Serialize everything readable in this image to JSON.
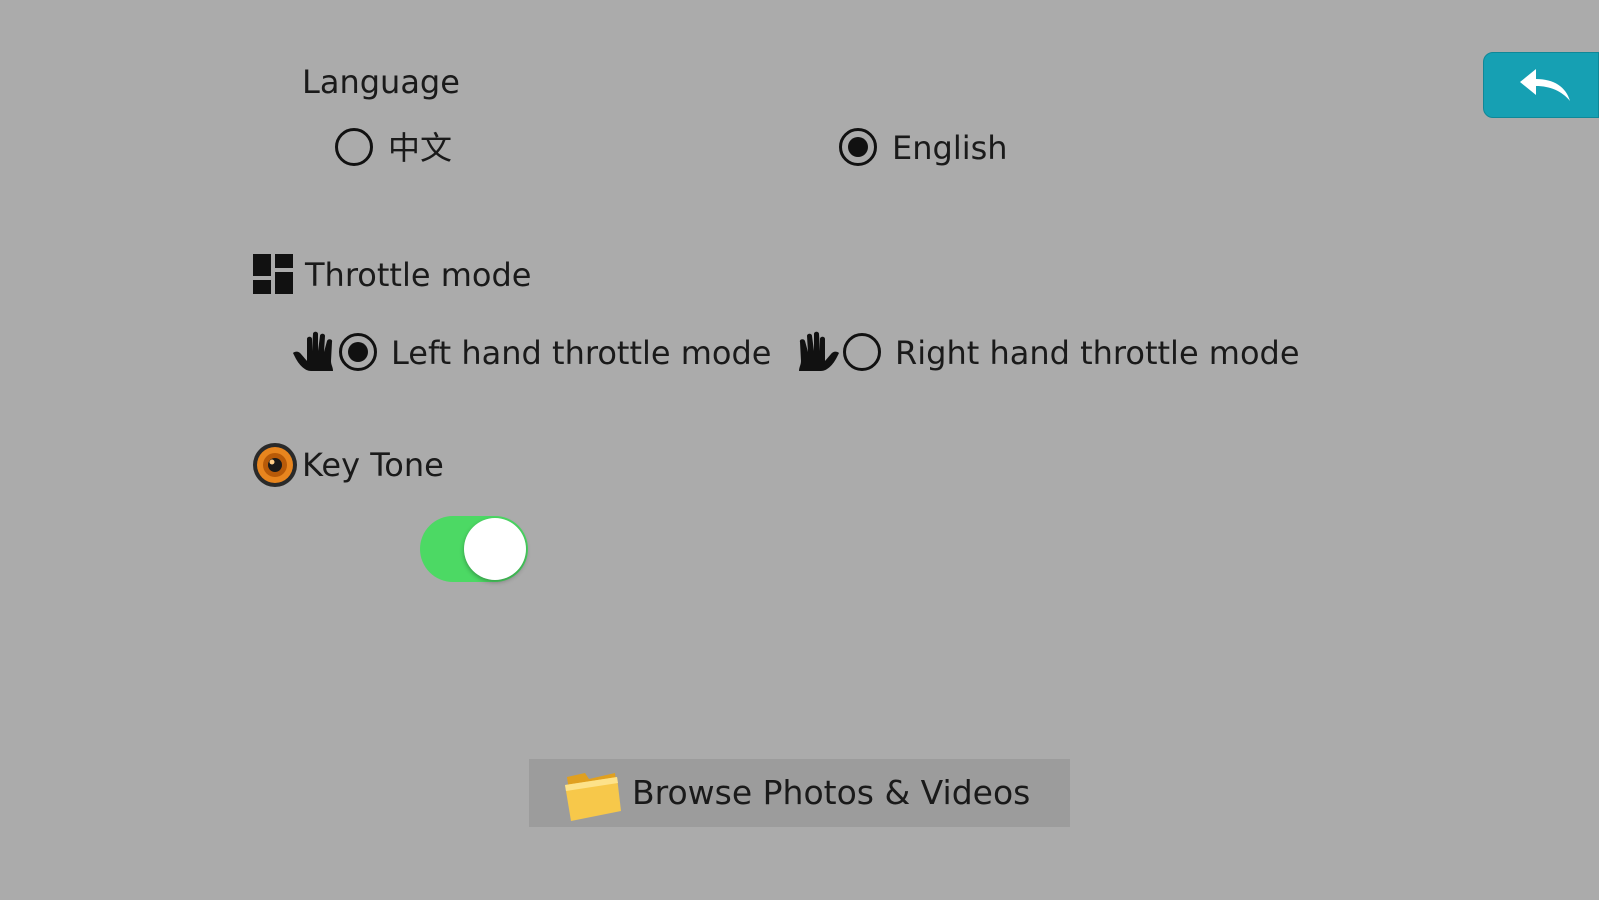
{
  "header": {
    "back_icon": "undo-arrow-icon"
  },
  "language": {
    "title": "Language",
    "options": [
      {
        "label": "中文",
        "checked": false
      },
      {
        "label": "English",
        "checked": true
      }
    ]
  },
  "throttle": {
    "title": "Throttle mode",
    "title_icon": "grid-layout-icon",
    "options": [
      {
        "label": "Left hand throttle mode",
        "checked": true,
        "icon": "left-hand-icon"
      },
      {
        "label": "Right hand throttle mode",
        "checked": false,
        "icon": "right-hand-icon"
      }
    ]
  },
  "key_tone": {
    "title": "Key Tone",
    "icon": "speaker-icon",
    "enabled": true
  },
  "browse": {
    "label": "Browse Photos & Videos",
    "icon": "folder-icon"
  },
  "colors": {
    "background": "#ababab",
    "back_button": "#16a0b3",
    "toggle_on": "#4cd964",
    "browse_button": "#9c9c9c"
  }
}
